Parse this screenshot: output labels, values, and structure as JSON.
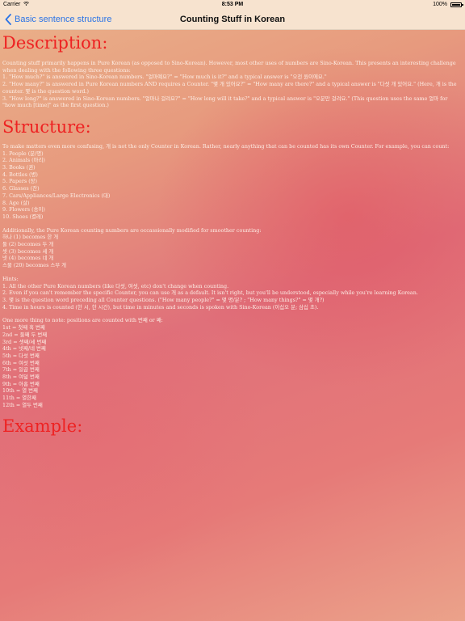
{
  "status_bar": {
    "carrier": "Carrier",
    "time": "8:53 PM",
    "battery": "100%"
  },
  "nav": {
    "back_label": "Basic sentence structure",
    "title": "Counting Stuff in Korean"
  },
  "colors": {
    "heading": "#ee2222",
    "body_text": "#fdeee6",
    "link": "#2a73e6",
    "bar": "#f7e3cf"
  },
  "description": {
    "heading": "Description:",
    "intro": "Counting stuff primarily happens in Pure Korean (as opposed to Sino-Korean). However, most other uses of numbers are Sino-Korean. This presents an interesting challenge when dealing with the following three questions:",
    "q1": "1. \"How much?\" is answered in Sino-Korean numbers. \"얼마예요?\" = \"How much is it?\" and a typical answer is \"오천 원이에요.\"",
    "q2": "2. \"How many?\" is answered in Pure Korean numbers AND requires a Counter. \"몇 개 있어요?\" = \"How many are there?\" and a typical answer is \"다섯 개 있어요.\" (Here, 개 is the counter. 몇 is the question word.)",
    "q3": "3. \"How long?\" is answered in Sino-Korean numbers. \"얼마나 걸려요?\" = \"How long will it take?\" and a typical answer is \"오분만 걸려요.\" (This question uses the same 얼마 for \"how much [time]\" as the first question.)"
  },
  "structure": {
    "heading": "Structure:",
    "intro": "To make matters even more confusing, 개 is not the only Counter in Korean. Rather, nearly anything that can be counted has its own Counter. For example, you can count:",
    "counters": [
      "1. People (분/명)",
      "2. Animals (마리)",
      "3. Books (권)",
      "4. Bottles (병)",
      "5. Papers (장)",
      "6. Glasses (잔)",
      "7. Cars/Appliances/Large Electronics (대)",
      "8. Age (살)",
      "9. Flowers (송이)",
      "10. Shoes (켤레)"
    ],
    "modified_intro": "Additionally, the Pure Korean counting numbers are occassionally modified for smoother counting:",
    "modified": [
      "하나 (1) becomes 한 개",
      "둘 (2) becomes 두 개",
      "셋 (3) becomes 세 개",
      "넷 (4) becomes 네 개",
      "스물 (20) becomes 스무 개"
    ],
    "hints_label": "Hints:",
    "hints": [
      "1. All the other Pure Korean numbers (like 다섯, 여섯, etc) don't change when counting.",
      "2. Even if you can't remember the specific Counter, you can use 개 as a default. It isn't right, but you'll be understood, especially while you're learning Korean.",
      "3. 몇 is the question word preceding all Counter questions. (\"How many people?\" = 몇 명/분? ; \"How many things?\" = 몇 개?)",
      "4. Time in hours is counted (한 시, 한 시간), but time in minutes and seconds is spoken with Sino-Korean (이십오 분; 삼십 초)."
    ],
    "positions_intro": "One more thing to note: positions are counted with 번째 or 째:",
    "positions": [
      "1st = 첫째 혹 번째",
      "2nd = 둘째 두 번째",
      "3rd = 셋째/세 번째",
      "4th = 넷째/네 번째",
      "5th = 다섯 번째",
      "6th = 여섯 번째",
      "7th = 일곱 번째",
      "8th = 여덟 번째",
      "9th = 아홉 번째",
      "10th = 열 번째",
      "11th = 열한째",
      "12th = 열두 번째"
    ]
  },
  "example": {
    "heading": "Example:"
  }
}
